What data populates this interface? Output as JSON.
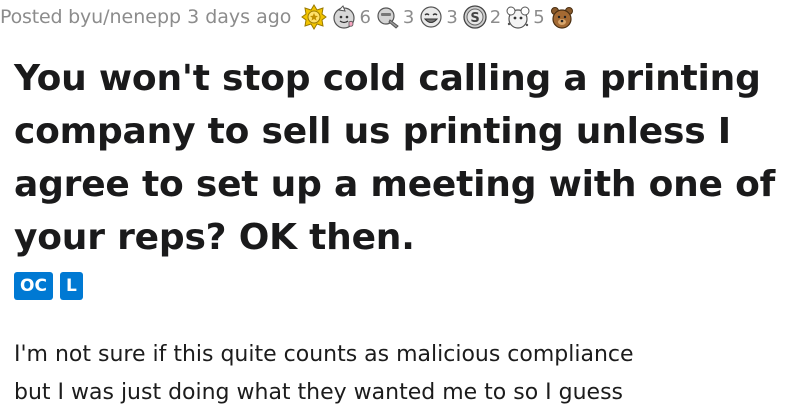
{
  "post": {
    "posted_prefix": "Posted by ",
    "author": "u/nenepp",
    "time_ago": "3 days ago",
    "awards": [
      {
        "icon": "gold-award-icon",
        "count": ""
      },
      {
        "icon": "wholesome-award-icon",
        "count": "6"
      },
      {
        "icon": "helpful-award-icon",
        "count": "3"
      },
      {
        "icon": "laughing-award-icon",
        "count": "3"
      },
      {
        "icon": "silver-coin-award-icon",
        "count": "2"
      },
      {
        "icon": "party-award-icon",
        "count": "5"
      },
      {
        "icon": "bear-award-icon",
        "count": ""
      }
    ],
    "title_lines": [
      "You won't stop cold calling a printing",
      "company to sell us printing unless I",
      "agree to set up a meeting with one of",
      "your reps? OK then."
    ],
    "flairs": [
      "OC",
      "L"
    ],
    "body_lines": [
      "I'm not sure if this quite counts as malicious compliance",
      "but I was just doing what they wanted me to so I guess"
    ],
    "colors": {
      "flair": "#0079d3",
      "meta": "#8c8c8c",
      "title": "#1a1a1b"
    }
  }
}
